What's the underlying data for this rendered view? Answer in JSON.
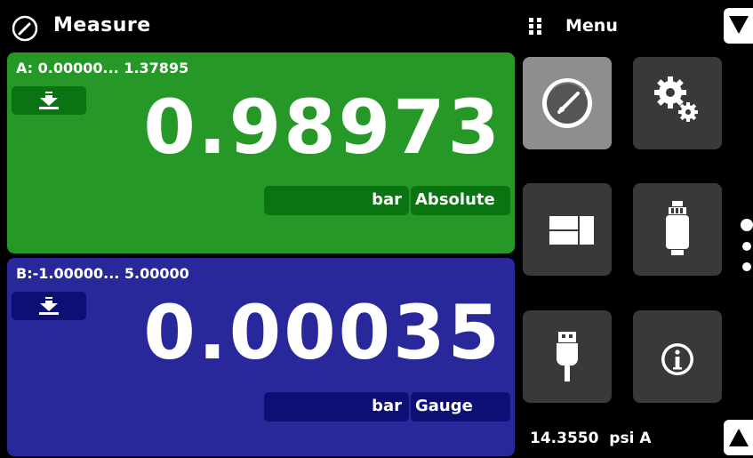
{
  "header": {
    "title": "Measure",
    "title_icon": "gauge-icon",
    "menu_label": "Menu",
    "menu_icon": "grip-icon"
  },
  "channel_a": {
    "range": "A: 0.00000... 1.37895",
    "reading": "0.98973",
    "unit": "bar",
    "mode": "Absolute",
    "tare_icon": "tare-down-arrow-icon",
    "color": "#259827"
  },
  "channel_b": {
    "range": "B:-1.00000... 5.00000",
    "reading": "0.00035",
    "unit": "bar",
    "mode": "Gauge",
    "tare_icon": "tare-down-arrow-icon",
    "color": "#28289b"
  },
  "menu_tiles": [
    {
      "icon": "gauge-icon",
      "active": true
    },
    {
      "icon": "settings-gears-icon",
      "active": false
    },
    {
      "icon": "display-layout-icon",
      "active": false
    },
    {
      "icon": "sensor-module-icon",
      "active": false
    },
    {
      "icon": "usb-icon",
      "active": false
    },
    {
      "icon": "info-icon",
      "active": false
    }
  ],
  "pager": {
    "pages": 3,
    "current": 1
  },
  "footer": {
    "barometer_value": "14.3550",
    "barometer_unit": "psi A"
  }
}
